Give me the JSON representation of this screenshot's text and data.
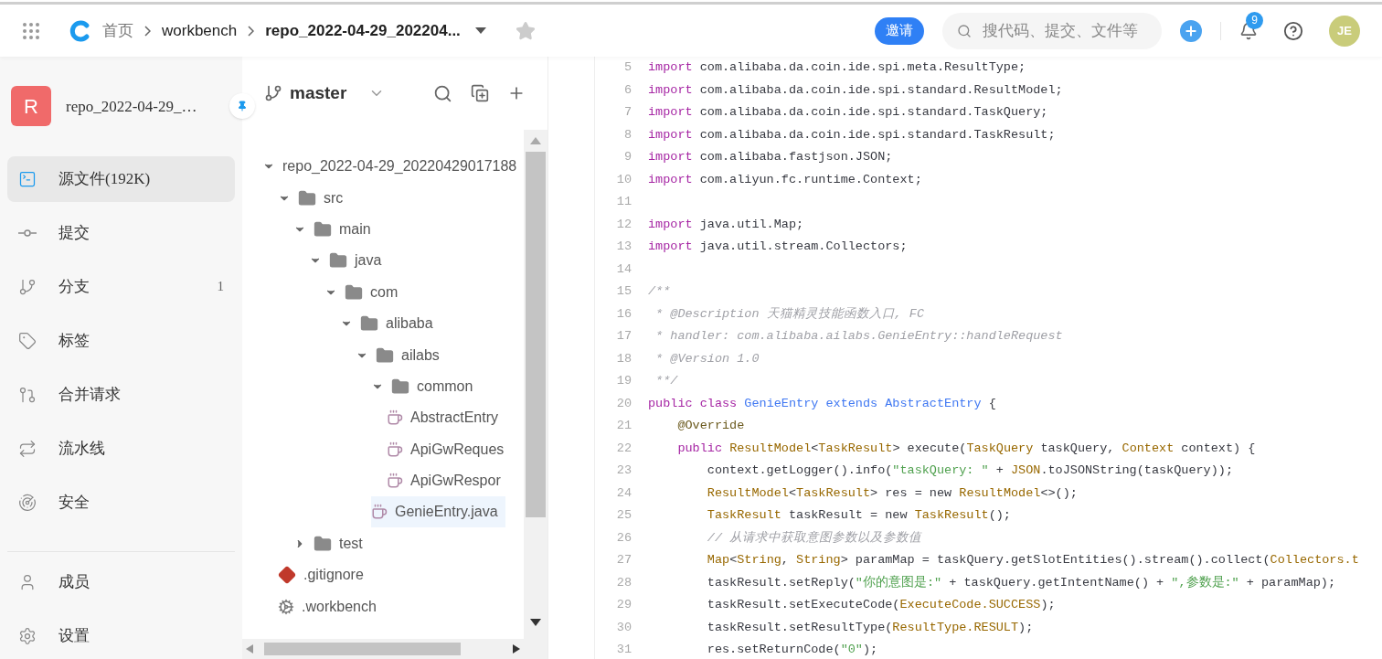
{
  "header": {
    "breadcrumbs": [
      {
        "label": "首页",
        "kind": "link"
      },
      {
        "label": "workbench",
        "kind": "link"
      },
      {
        "label": "repo_2022-04-29_202204...",
        "kind": "current"
      }
    ],
    "starred": false,
    "invite_button": "邀请",
    "search": {
      "placeholder": "搜代码、提交、文件等"
    },
    "notifications": "9",
    "avatar": "JE"
  },
  "repo": {
    "initial": "R",
    "name": "repo_2022-04-29_…",
    "pinned": true
  },
  "sidebar": {
    "items": [
      {
        "label": "源文件(192K)",
        "selected": true
      },
      {
        "label": "提交",
        "selected": false
      },
      {
        "label": "分支",
        "selected": false,
        "count": "1"
      },
      {
        "label": "标签",
        "selected": false
      },
      {
        "label": "合并请求",
        "selected": false
      },
      {
        "label": "流水线",
        "selected": false
      },
      {
        "label": "安全",
        "selected": false
      }
    ],
    "bottom_items": [
      {
        "label": "成员",
        "selected": false
      },
      {
        "label": "设置",
        "selected": false
      }
    ]
  },
  "file_tree": {
    "branch": "master",
    "items": [
      {
        "name": "repo_2022-04-29_20220429017188",
        "kind": "root",
        "expanded": true,
        "selected": false,
        "children": [
          {
            "name": "src",
            "kind": "folder",
            "expanded": true,
            "selected": false,
            "children": [
              {
                "name": "main",
                "kind": "folder",
                "expanded": true,
                "selected": false,
                "children": [
                  {
                    "name": "java",
                    "kind": "folder",
                    "expanded": true,
                    "selected": false,
                    "children": [
                      {
                        "name": "com",
                        "kind": "folder",
                        "expanded": true,
                        "selected": false,
                        "children": [
                          {
                            "name": "alibaba",
                            "kind": "folder",
                            "expanded": true,
                            "selected": false,
                            "children": [
                              {
                                "name": "ailabs",
                                "kind": "folder",
                                "expanded": true,
                                "selected": false,
                                "children": [
                                  {
                                    "name": "common",
                                    "kind": "folder",
                                    "expanded": true,
                                    "selected": false,
                                    "children": [
                                      {
                                        "name": "AbstractEntry",
                                        "kind": "java",
                                        "selected": false
                                      },
                                      {
                                        "name": "ApiGwReques",
                                        "kind": "java",
                                        "selected": false
                                      },
                                      {
                                        "name": "ApiGwRespor",
                                        "kind": "java",
                                        "selected": false
                                      }
                                    ]
                                  },
                                  {
                                    "name": "GenieEntry.java",
                                    "kind": "java",
                                    "selected": true
                                  }
                                ]
                              }
                            ]
                          }
                        ]
                      }
                    ]
                  }
                ]
              },
              {
                "name": "test",
                "kind": "folder",
                "expanded": false,
                "selected": false
              }
            ]
          },
          {
            "name": ".gitignore",
            "kind": "git",
            "selected": false
          },
          {
            "name": ".workbench",
            "kind": "config",
            "selected": false
          }
        ]
      }
    ]
  },
  "code": {
    "lines": [
      {
        "number": "5",
        "tokens": [
          {
            "kind": "kw",
            "text": "import"
          },
          {
            "kind": "plain",
            "text": " com.alibaba.da.coin.ide.spi.meta.ResultType;"
          }
        ]
      },
      {
        "number": "6",
        "tokens": [
          {
            "kind": "kw",
            "text": "import"
          },
          {
            "kind": "plain",
            "text": " com.alibaba.da.coin.ide.spi.standard.ResultModel;"
          }
        ]
      },
      {
        "number": "7",
        "tokens": [
          {
            "kind": "kw",
            "text": "import"
          },
          {
            "kind": "plain",
            "text": " com.alibaba.da.coin.ide.spi.standard.TaskQuery;"
          }
        ]
      },
      {
        "number": "8",
        "tokens": [
          {
            "kind": "kw",
            "text": "import"
          },
          {
            "kind": "plain",
            "text": " com.alibaba.da.coin.ide.spi.standard.TaskResult;"
          }
        ]
      },
      {
        "number": "9",
        "tokens": [
          {
            "kind": "kw",
            "text": "import"
          },
          {
            "kind": "plain",
            "text": " com.alibaba.fastjson.JSON;"
          }
        ]
      },
      {
        "number": "10",
        "tokens": [
          {
            "kind": "kw",
            "text": "import"
          },
          {
            "kind": "plain",
            "text": " com.aliyun.fc.runtime.Context;"
          }
        ]
      },
      {
        "number": "11"
      },
      {
        "number": "12",
        "tokens": [
          {
            "kind": "kw",
            "text": "import"
          },
          {
            "kind": "plain",
            "text": " java.util.Map;"
          }
        ]
      },
      {
        "number": "13",
        "tokens": [
          {
            "kind": "kw",
            "text": "import"
          },
          {
            "kind": "plain",
            "text": " java.util.stream.Collectors;"
          }
        ]
      },
      {
        "number": "14"
      },
      {
        "number": "15",
        "tokens": [
          {
            "kind": "comment",
            "text": "/**"
          }
        ]
      },
      {
        "number": "16",
        "tokens": [
          {
            "kind": "comment",
            "text": " * @Description 天猫精灵技能函数入口, FC"
          }
        ]
      },
      {
        "number": "17",
        "tokens": [
          {
            "kind": "comment",
            "text": " * handler: com.alibaba.ailabs.GenieEntry::handleRequest"
          }
        ]
      },
      {
        "number": "18",
        "tokens": [
          {
            "kind": "comment",
            "text": " * @Version 1.0"
          }
        ]
      },
      {
        "number": "19",
        "tokens": [
          {
            "kind": "comment",
            "text": " **/"
          }
        ]
      },
      {
        "number": "20",
        "tokens": [
          {
            "kind": "kw",
            "text": "public class "
          },
          {
            "kind": "cls",
            "text": "GenieEntry extends AbstractEntry"
          },
          {
            "kind": "plain",
            "text": " {"
          }
        ]
      },
      {
        "number": "21",
        "tokens": [
          {
            "kind": "annot",
            "text": "    @Override"
          }
        ]
      },
      {
        "number": "22",
        "tokens": [
          {
            "kind": "kw",
            "text": "    public "
          },
          {
            "kind": "type",
            "text": "ResultModel"
          },
          {
            "kind": "plain",
            "text": "<"
          },
          {
            "kind": "type",
            "text": "TaskResult"
          },
          {
            "kind": "plain",
            "text": "> execute("
          },
          {
            "kind": "type",
            "text": "TaskQuery"
          },
          {
            "kind": "plain",
            "text": " taskQuery, "
          },
          {
            "kind": "type",
            "text": "Context"
          },
          {
            "kind": "plain",
            "text": " context) {"
          }
        ]
      },
      {
        "number": "23",
        "tokens": [
          {
            "kind": "plain",
            "text": "        context.getLogger().info("
          },
          {
            "kind": "str",
            "text": "\"taskQuery: \""
          },
          {
            "kind": "plain",
            "text": " + "
          },
          {
            "kind": "type",
            "text": "JSON"
          },
          {
            "kind": "plain",
            "text": ".toJSONString(taskQuery));"
          }
        ]
      },
      {
        "number": "24",
        "tokens": [
          {
            "kind": "type",
            "text": "        ResultModel"
          },
          {
            "kind": "plain",
            "text": "<"
          },
          {
            "kind": "type",
            "text": "TaskResult"
          },
          {
            "kind": "plain",
            "text": "> res = new "
          },
          {
            "kind": "type",
            "text": "ResultModel"
          },
          {
            "kind": "plain",
            "text": "<>();"
          }
        ]
      },
      {
        "number": "25",
        "tokens": [
          {
            "kind": "type",
            "text": "        TaskResult"
          },
          {
            "kind": "plain",
            "text": " taskResult = new "
          },
          {
            "kind": "type",
            "text": "TaskResult"
          },
          {
            "kind": "plain",
            "text": "();"
          }
        ]
      },
      {
        "number": "26",
        "tokens": [
          {
            "kind": "comment",
            "text": "        // 从请求中获取意图参数以及参数值"
          }
        ]
      },
      {
        "number": "27",
        "tokens": [
          {
            "kind": "type",
            "text": "        Map"
          },
          {
            "kind": "plain",
            "text": "<"
          },
          {
            "kind": "type",
            "text": "String"
          },
          {
            "kind": "plain",
            "text": ", "
          },
          {
            "kind": "type",
            "text": "String"
          },
          {
            "kind": "plain",
            "text": "> paramMap = taskQuery.getSlotEntities().stream().collect("
          },
          {
            "kind": "type",
            "text": "Collectors.t"
          }
        ]
      },
      {
        "number": "28",
        "tokens": [
          {
            "kind": "plain",
            "text": "        taskResult.setReply("
          },
          {
            "kind": "str",
            "text": "\"你的意图是:\""
          },
          {
            "kind": "plain",
            "text": " + taskQuery.getIntentName() + "
          },
          {
            "kind": "str",
            "text": "\",参数是:\""
          },
          {
            "kind": "plain",
            "text": " + paramMap);"
          }
        ]
      },
      {
        "number": "29",
        "tokens": [
          {
            "kind": "plain",
            "text": "        taskResult.setExecuteCode("
          },
          {
            "kind": "type",
            "text": "ExecuteCode.SUCCESS"
          },
          {
            "kind": "plain",
            "text": ");"
          }
        ]
      },
      {
        "number": "30",
        "tokens": [
          {
            "kind": "plain",
            "text": "        taskResult.setResultType("
          },
          {
            "kind": "type",
            "text": "ResultType.RESULT"
          },
          {
            "kind": "plain",
            "text": ");"
          }
        ]
      },
      {
        "number": "31",
        "tokens": [
          {
            "kind": "plain",
            "text": "        res.setReturnCode("
          },
          {
            "kind": "str",
            "text": "\"0\""
          },
          {
            "kind": "plain",
            "text": ");"
          }
        ]
      }
    ]
  }
}
